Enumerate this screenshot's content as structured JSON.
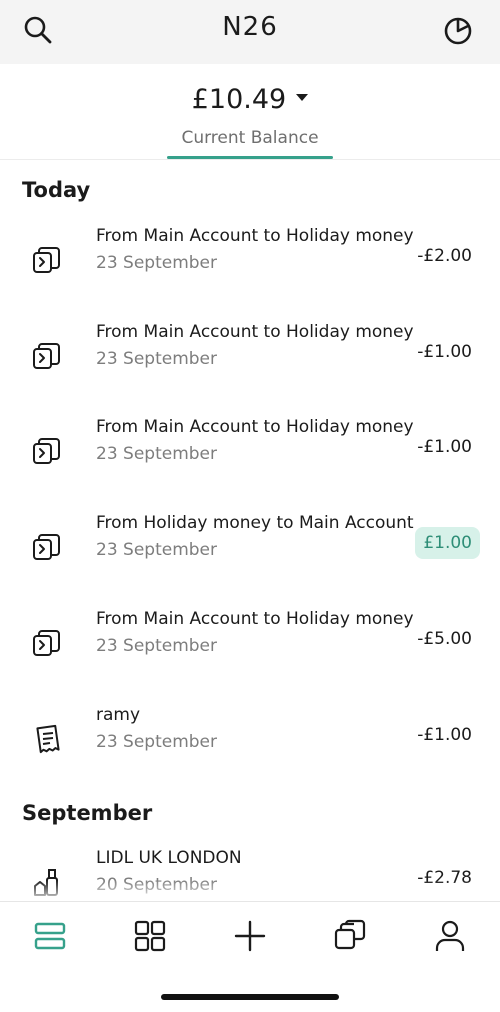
{
  "header": {
    "logo": "N26",
    "search_icon": "search-icon",
    "stats_icon": "pie-chart-icon"
  },
  "balance": {
    "amount": "£10.49",
    "label": "Current Balance",
    "accent_color": "#36a18b"
  },
  "sections": [
    {
      "title": "Today",
      "transactions": [
        {
          "title": "From Main Account to Holiday money",
          "date": "23 September",
          "amount": "-£2.00",
          "icon": "transfer-icon"
        },
        {
          "title": "From Main Account to Holiday money",
          "date": "23 September",
          "amount": "-£1.00",
          "icon": "transfer-icon"
        },
        {
          "title": "From Main Account to Holiday money",
          "date": "23 September",
          "amount": "-£1.00",
          "icon": "transfer-icon"
        },
        {
          "title": "From Holiday money to Main Account",
          "date": "23 September",
          "amount": "£1.00",
          "icon": "transfer-icon",
          "positive": true
        },
        {
          "title": "From Main Account to Holiday money",
          "date": "23 September",
          "amount": "-£5.00",
          "icon": "transfer-icon"
        },
        {
          "title": "ramy",
          "date": "23 September",
          "amount": "-£1.00",
          "icon": "receipt-icon"
        }
      ]
    },
    {
      "title": "September",
      "transactions": [
        {
          "title": "LIDL UK LONDON",
          "date": "20 September",
          "amount": "-£2.78",
          "icon": "groceries-icon"
        }
      ]
    }
  ],
  "bottom_nav": [
    {
      "name": "transactions-tab",
      "icon": "list-icon",
      "active": true
    },
    {
      "name": "dashboard-tab",
      "icon": "grid-icon"
    },
    {
      "name": "add-tab",
      "icon": "plus-icon"
    },
    {
      "name": "spaces-tab",
      "icon": "spaces-icon"
    },
    {
      "name": "profile-tab",
      "icon": "person-icon"
    }
  ]
}
